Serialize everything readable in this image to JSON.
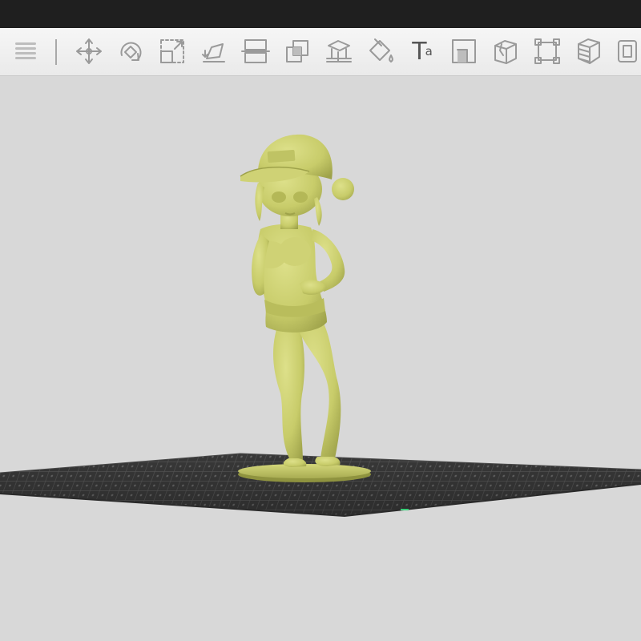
{
  "app": {
    "window_title": ""
  },
  "toolbar": {
    "tools": [
      {
        "name": "menu",
        "icon": "menu-icon"
      },
      {
        "name": "move",
        "icon": "move-icon"
      },
      {
        "name": "rotate",
        "icon": "rotate-icon"
      },
      {
        "name": "scale",
        "icon": "scale-icon"
      },
      {
        "name": "lay-flat",
        "icon": "lay-flat-icon"
      },
      {
        "name": "cut",
        "icon": "cut-icon"
      },
      {
        "name": "duplicate",
        "icon": "duplicate-icon"
      },
      {
        "name": "support",
        "icon": "support-icon"
      },
      {
        "name": "paint",
        "icon": "paint-bucket-icon"
      },
      {
        "name": "text",
        "icon": "text-icon",
        "glyph": "T",
        "sub": "a"
      },
      {
        "name": "hollow",
        "icon": "hollow-icon"
      },
      {
        "name": "split",
        "icon": "split-cube-icon"
      },
      {
        "name": "repair",
        "icon": "repair-frame-icon"
      },
      {
        "name": "layers",
        "icon": "layers-icon"
      },
      {
        "name": "more",
        "icon": "copy-icon"
      }
    ]
  },
  "scene": {
    "model_color": "#c8cc6a",
    "bed_color": "#3e3e3e",
    "background_color": "#d8d8d8"
  }
}
